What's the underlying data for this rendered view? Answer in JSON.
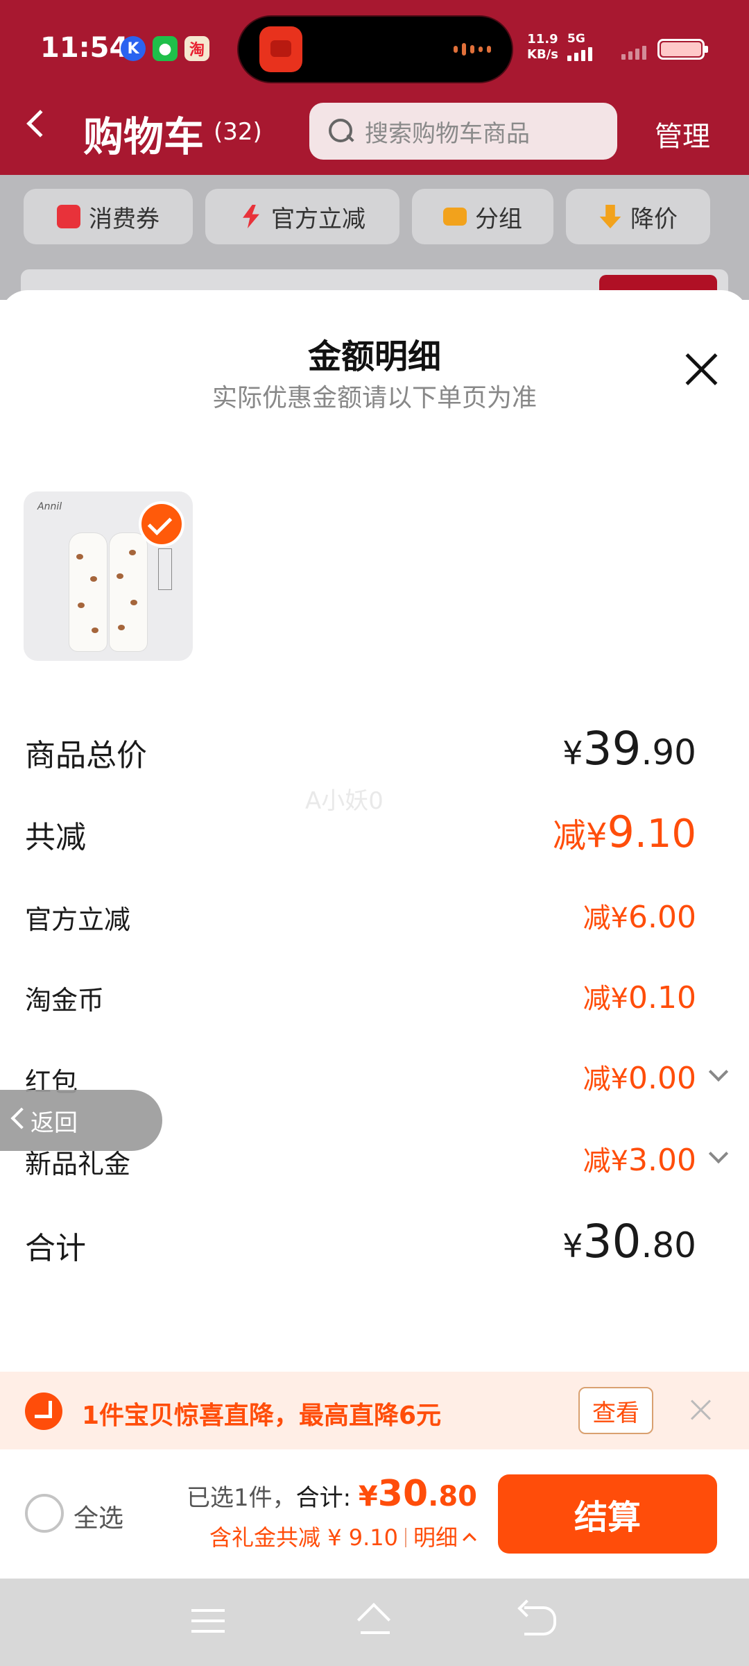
{
  "status_bar": {
    "time": "11:54",
    "net_speed_value": "11.9",
    "net_speed_unit": "KB/s",
    "network": "5G",
    "notification_icons": [
      "k-app-icon",
      "wechat-icon",
      "taobao-icon"
    ]
  },
  "header": {
    "title": "购物车",
    "count": "(32)",
    "search_placeholder": "搜索购物车商品",
    "manage_label": "管理"
  },
  "filter_chips": [
    {
      "label": "消费券",
      "icon": "coupon-icon",
      "color": "#e8323a"
    },
    {
      "label": "官方立减",
      "icon": "lightning-icon",
      "color": "#e8323a"
    },
    {
      "label": "分组",
      "icon": "folder-icon",
      "color": "#f2a21c"
    },
    {
      "label": "降价",
      "icon": "price-drop-icon",
      "color": "#f2a21c"
    }
  ],
  "sheet": {
    "title": "金额明细",
    "subtitle": "实际优惠金额请以下单页为准",
    "product_selected": true,
    "rows": {
      "total_price": {
        "label": "商品总价",
        "yen": "¥",
        "int": "39",
        "dec": ".90"
      },
      "total_discount": {
        "label": "共减",
        "prefix": "减¥",
        "int": "9",
        "dec": ".10"
      },
      "official_discount": {
        "label": "官方立减",
        "prefix": "减¥",
        "int": "6",
        "dec": ".00"
      },
      "taojin_coin": {
        "label": "淘金币",
        "prefix": "减¥",
        "int": "0",
        "dec": ".10"
      },
      "red_packet": {
        "label": "红包",
        "prefix": "减¥",
        "int": "0",
        "dec": ".00"
      },
      "new_gift": {
        "label": "新品礼金",
        "prefix": "减¥",
        "int": "3",
        "dec": ".00"
      },
      "sum": {
        "label": "合计",
        "yen": "¥",
        "int": "30",
        "dec": ".80"
      }
    },
    "watermark": "A小妖0",
    "return_label": "返回"
  },
  "promo": {
    "text": "1件宝贝惊喜直降，最高直降6元",
    "button": "查看"
  },
  "checkout": {
    "select_all": "全选",
    "selected_prefix": "已选1件，",
    "total_label": "合计: ",
    "total_yen": "¥",
    "total_int": "30",
    "total_dec": ".80",
    "discount_note": "含礼金共减 ¥ 9.10",
    "detail_label": "明细",
    "checkout_label": "结算"
  },
  "colors": {
    "accent": "#ff4d0a",
    "header_bg": "#a81830",
    "promo_bg": "#ffeee6"
  }
}
